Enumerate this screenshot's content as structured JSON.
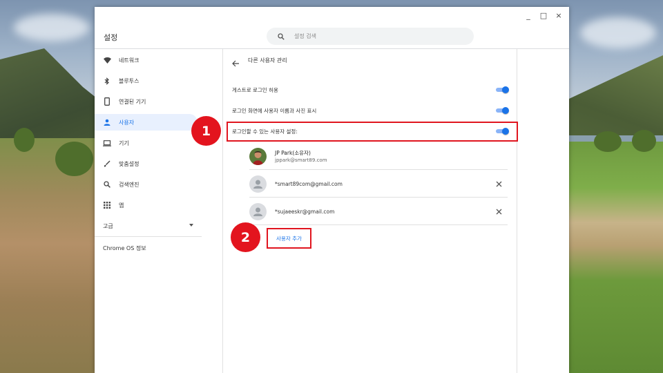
{
  "window": {
    "title": "설정",
    "controls": {
      "minimize": "_",
      "maximize": "□",
      "close": "×"
    }
  },
  "search": {
    "placeholder": "설정 검색",
    "value": ""
  },
  "sidebar": {
    "items": [
      {
        "label": "네트워크",
        "icon": "wifi-icon"
      },
      {
        "label": "블루투스",
        "icon": "bluetooth-icon"
      },
      {
        "label": "연결된 기기",
        "icon": "phone-icon"
      },
      {
        "label": "사용자",
        "icon": "person-icon",
        "active": true
      },
      {
        "label": "기기",
        "icon": "laptop-icon"
      },
      {
        "label": "맞춤설정",
        "icon": "brush-icon"
      },
      {
        "label": "검색엔진",
        "icon": "search-icon"
      },
      {
        "label": "앱",
        "icon": "apps-grid-icon"
      }
    ],
    "advanced_label": "고급",
    "about_label": "Chrome OS 정보"
  },
  "main": {
    "title": "다른 사용자 관리",
    "settings": [
      {
        "label": "게스트로 로그인 허용",
        "enabled": true
      },
      {
        "label": "로그인 화면에 사용자 이름과 사진 표시",
        "enabled": true
      },
      {
        "label": "로그인할 수 있는 사용자 설정:",
        "enabled": true
      }
    ],
    "users": [
      {
        "name": "JP Park(소유자)",
        "email": "jppark@smart89.com",
        "owner": true
      },
      {
        "email": "*smart89com@gmail.com"
      },
      {
        "email": "*sujaeeskr@gmail.com"
      }
    ],
    "add_user_label": "사용자 추가"
  },
  "callouts": {
    "one": "1",
    "two": "2"
  },
  "colors": {
    "accent": "#1a73e8",
    "highlight": "#e0141e",
    "active_bg": "#e8f0fe"
  }
}
